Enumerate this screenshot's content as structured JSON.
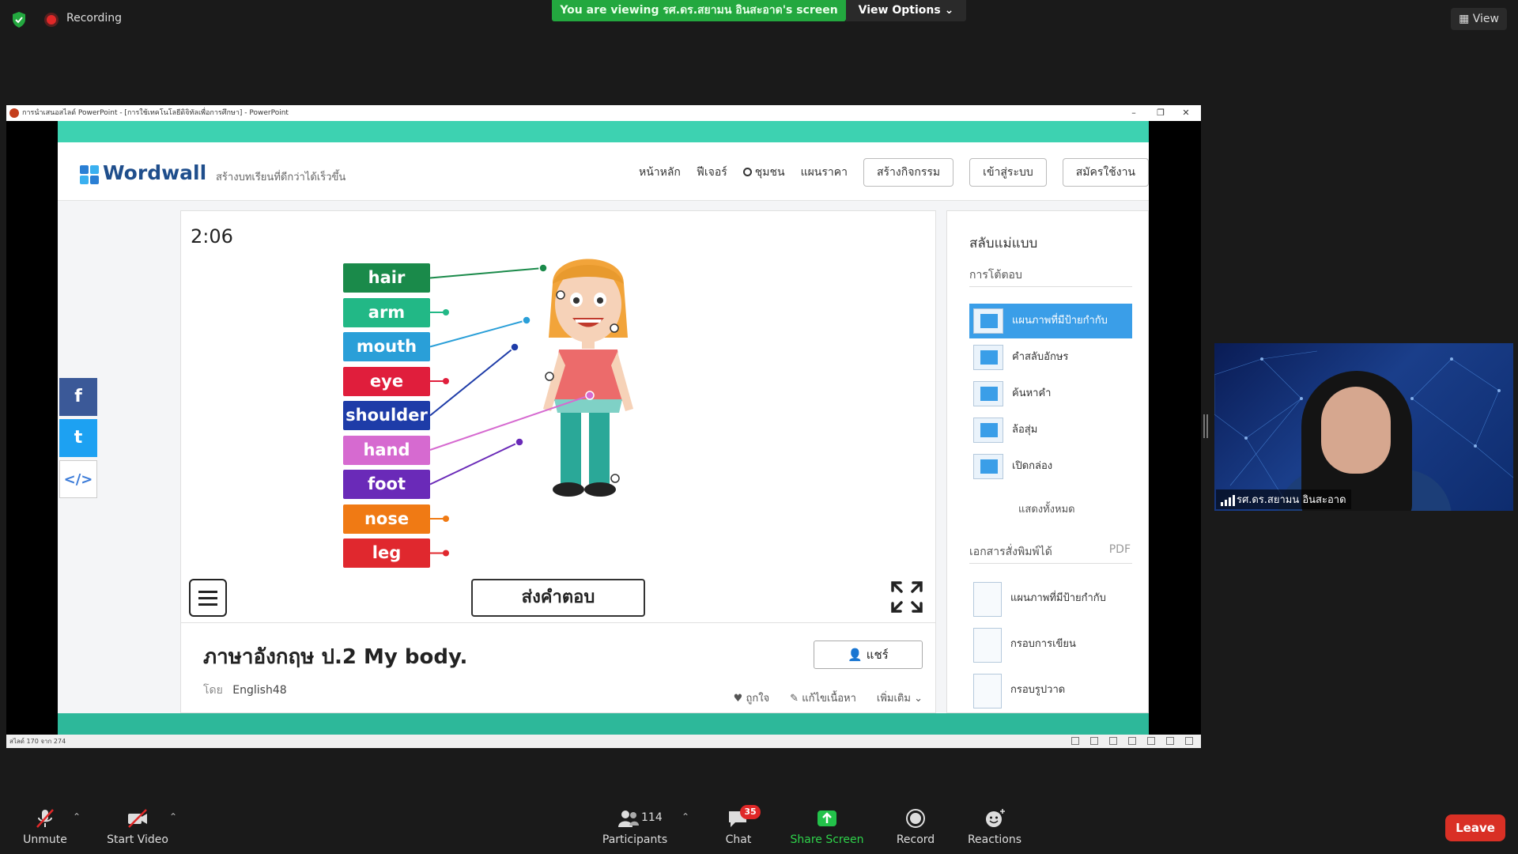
{
  "top_bar": {
    "recording_label": "Recording",
    "viewing_banner": "You are viewing รศ.ดร.สยามน อินสะอาด's screen",
    "view_options_label": "View Options",
    "view_label": "View"
  },
  "ppt_window": {
    "title": "การนำเสนอสไลด์ PowerPoint - [การใช้เทคโนโลยีดิจิทัลเพื่อการศึกษา] - PowerPoint",
    "status_text": "สไลด์ 170 จาก 274"
  },
  "wordwall": {
    "logo_text": "Wordwall",
    "tagline": "สร้างบทเรียนที่ดีกว่าได้เร็วขึ้น",
    "nav": {
      "home": "หน้าหลัก",
      "features": "ฟีเจอร์",
      "community": "ชุมชน",
      "pricing": "แผนราคา",
      "create_activity": "สร้างกิจกรรม",
      "login": "เข้าสู่ระบบ",
      "signup": "สมัครใช้งาน"
    },
    "social": {
      "facebook": "f",
      "twitter": "t",
      "embed": "</>"
    },
    "game": {
      "timer": "2:06",
      "labels": [
        {
          "text": "hair",
          "color": "#1a8a4a"
        },
        {
          "text": "arm",
          "color": "#22b886"
        },
        {
          "text": "mouth",
          "color": "#2a9fd8"
        },
        {
          "text": "eye",
          "color": "#e01e3c"
        },
        {
          "text": "shoulder",
          "color": "#1e3ca8"
        },
        {
          "text": "hand",
          "color": "#d66ad0"
        },
        {
          "text": "foot",
          "color": "#6a2ab8"
        },
        {
          "text": "nose",
          "color": "#f07a14"
        },
        {
          "text": "leg",
          "color": "#e0282e"
        }
      ],
      "submit_label": "ส่งคำตอบ"
    },
    "info": {
      "title": "ภาษาอังกฤษ ป.2 My body.",
      "by_label": "โดย",
      "author": "English48",
      "share_label": "แชร์",
      "like_label": "ถูกใจ",
      "edit_label": "แก้ไขเนื้อหา",
      "more_label": "เพิ่มเติม"
    },
    "sidebar": {
      "title": "สลับแม่แบบ",
      "interactive_section": "การโต้ตอบ",
      "templates": [
        {
          "label": "แผนภาพที่มีป้ายกำกับ",
          "active": true
        },
        {
          "label": "คำสลับอักษร",
          "active": false
        },
        {
          "label": "ค้นหาคำ",
          "active": false
        },
        {
          "label": "ล้อสุ่ม",
          "active": false
        },
        {
          "label": "เปิดกล่อง",
          "active": false
        }
      ],
      "show_all": "แสดงทั้งหมด",
      "printable_section": "เอกสารสั่งพิมพ์ได้",
      "pdf_label": "PDF",
      "printables": [
        {
          "label": "แผนภาพที่มีป้ายกำกับ"
        },
        {
          "label": "กรอบการเขียน"
        },
        {
          "label": "กรอบรูปวาด"
        }
      ]
    }
  },
  "webcam": {
    "participant_name": "รศ.ดร.สยามน อินสะอาด"
  },
  "toolbar": {
    "unmute_label": "Unmute",
    "start_video_label": "Start Video",
    "participants_label": "Participants",
    "participants_count": "114",
    "chat_label": "Chat",
    "chat_badge": "35",
    "share_screen_label": "Share Screen",
    "record_label": "Record",
    "reactions_label": "Reactions",
    "leave_label": "Leave"
  }
}
